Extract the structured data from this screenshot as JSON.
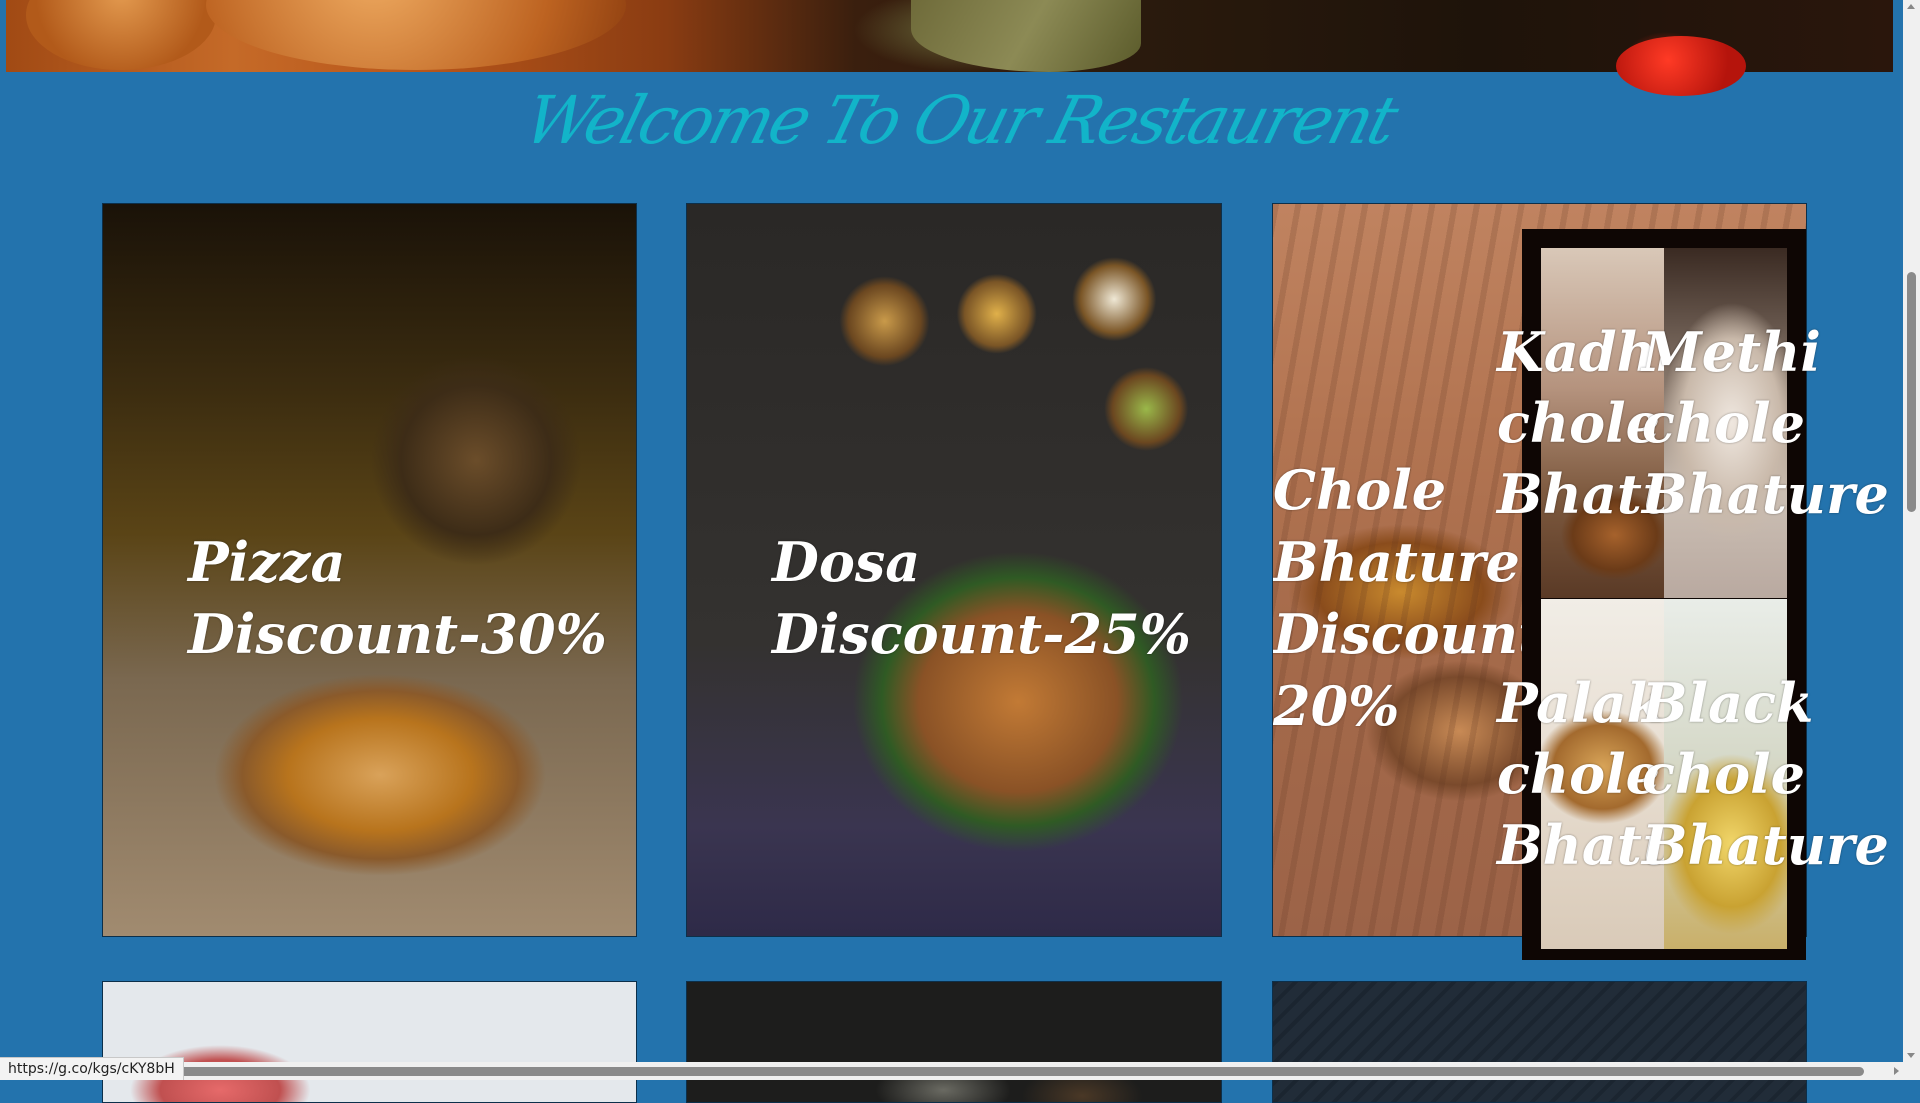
{
  "page": {
    "heading": "Welcome To Our Restaurent"
  },
  "cards": [
    {
      "title": "Pizza",
      "discount": "Discount-30%"
    },
    {
      "title": "Dosa",
      "discount": "Discount-25%"
    },
    {
      "title": "Chole Bhature",
      "discount": "Discount-20%"
    }
  ],
  "submenu": [
    {
      "name": "Kadhi chole Bhature"
    },
    {
      "name": "Methi chole Bhature"
    },
    {
      "name": "Palak chole Bhature"
    },
    {
      "name": "Black chole Bhature"
    }
  ],
  "status_bar": {
    "url": "https://g.co/kgs/cKY8bH"
  },
  "colors": {
    "background": "#2373ad",
    "heading": "#12b4c9"
  }
}
